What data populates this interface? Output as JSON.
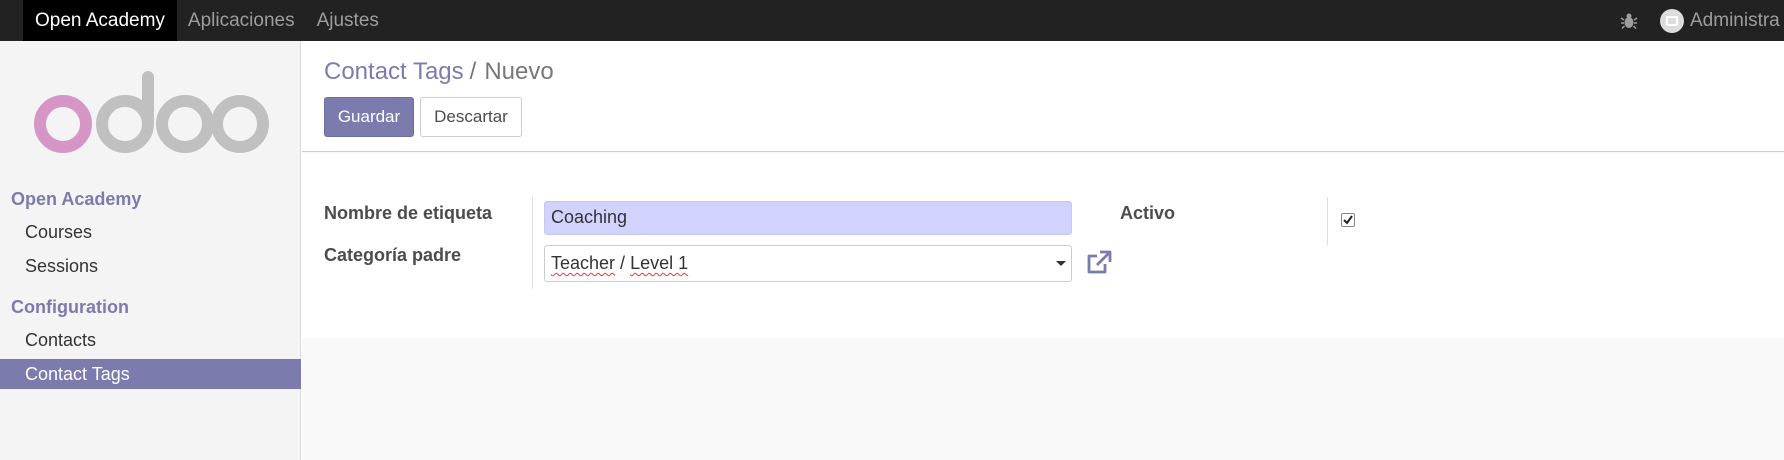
{
  "navbar": {
    "app_name": "Open Academy",
    "menu": [
      "Aplicaciones",
      "Ajustes"
    ],
    "user": "Administra"
  },
  "sidebar": {
    "logo": "odoo",
    "sections": [
      {
        "title": "Open Academy",
        "items": [
          "Courses",
          "Sessions"
        ]
      },
      {
        "title": "Configuration",
        "items": [
          "Contacts",
          "Contact Tags"
        ]
      }
    ],
    "active_item": "Contact Tags"
  },
  "breadcrumb": {
    "parent": "Contact Tags",
    "separator": "/",
    "current": "Nuevo"
  },
  "buttons": {
    "save": "Guardar",
    "discard": "Descartar"
  },
  "form": {
    "name_label": "Nombre de etiqueta",
    "name_value": "Coaching",
    "parent_label": "Categoría padre",
    "parent_value_part1": "Teacher",
    "parent_value_sep": " / ",
    "parent_value_part2": "Level 1",
    "active_label": "Activo",
    "active_checked": true
  },
  "icons": {
    "bug": "bug-icon",
    "avatar": "avatar-icon",
    "external": "external-link-icon",
    "caret": "caret-down-icon"
  },
  "colors": {
    "accent": "#7c7bad",
    "navbar": "#222222",
    "required_field": "#d2d2ff"
  }
}
